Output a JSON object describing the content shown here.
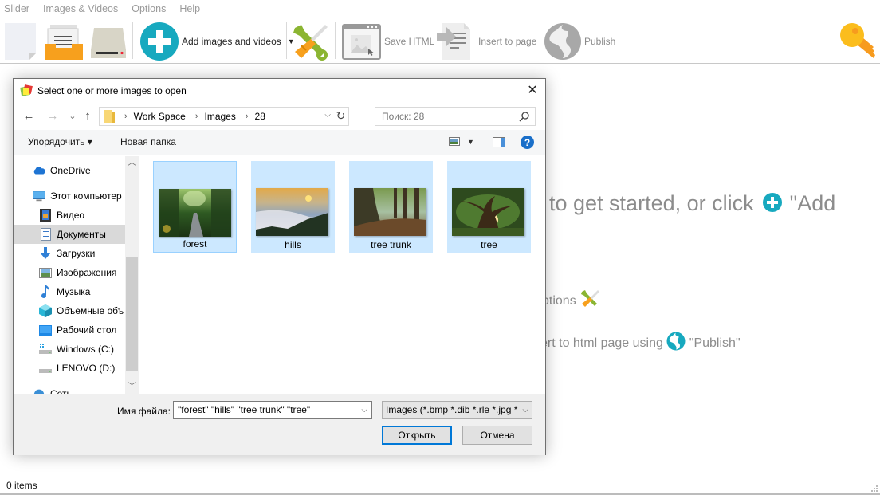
{
  "menubar": {
    "items": [
      "Slider",
      "Images & Videos",
      "Options",
      "Help"
    ]
  },
  "toolbar": {
    "new_icon": "blank-page-icon",
    "open_icon": "file-tray-icon",
    "save_icon": "disk-drive-icon",
    "add_label": "Add images and videos",
    "add_icon": "plus-circle-icon",
    "options_icon": "wrench-screwdriver-icon",
    "save_html_label": "Save HTML",
    "insert_label": "Insert to page",
    "publish_label": "Publish",
    "key_icon": "key-icon"
  },
  "colors": {
    "accent_teal": "#17a9bf",
    "orange": "#f5a623",
    "key_yellow": "#fbbd1d",
    "selection_blue": "#cce8ff",
    "primary_button_border": "#0078d7"
  },
  "welcome": {
    "line1_text": "to get started, or click",
    "line1_after": "\"Add",
    "line2_text": "ptions",
    "line3_text": "ert to html page using",
    "line3_after": "\"Publish\""
  },
  "status": {
    "items_count": "0 items"
  },
  "dialog": {
    "title": "Select one or more images to open",
    "close_label": "✕",
    "nav": {
      "back": "←",
      "forward": "→",
      "recent": "⌄",
      "up": "↑"
    },
    "breadcrumb": [
      "Work Space",
      "Images",
      "28"
    ],
    "search_placeholder": "Поиск: 28",
    "commands": {
      "organize": "Упорядочить ▾",
      "new_folder": "Новая папка"
    },
    "nav_pane": [
      {
        "label": "OneDrive",
        "icon": "onedrive-cloud-icon"
      },
      {
        "label": "Этот компьютер",
        "icon": "computer-icon"
      },
      {
        "label": "Видео",
        "icon": "video-icon"
      },
      {
        "label": "Документы",
        "icon": "documents-icon",
        "selected": true
      },
      {
        "label": "Загрузки",
        "icon": "downloads-icon"
      },
      {
        "label": "Изображения",
        "icon": "pictures-icon"
      },
      {
        "label": "Музыка",
        "icon": "music-icon"
      },
      {
        "label": "Объемные объ",
        "icon": "3d-objects-icon"
      },
      {
        "label": "Рабочий стол",
        "icon": "desktop-icon"
      },
      {
        "label": "Windows (C:)",
        "icon": "windows-drive-icon"
      },
      {
        "label": "LENOVO (D:)",
        "icon": "drive-icon"
      },
      {
        "label": "Сеть",
        "icon": "network-icon"
      }
    ],
    "files": [
      {
        "name": "forest",
        "focused": true
      },
      {
        "name": "hills",
        "focused": false
      },
      {
        "name": "tree trunk",
        "focused": false
      },
      {
        "name": "tree",
        "focused": false
      }
    ],
    "filename_label": "Имя файла:",
    "filename_value": "\"forest\" \"hills\" \"tree trunk\" \"tree\"",
    "filetype_value": "Images (*.bmp *.dib *.rle *.jpg *",
    "open_button": "Открыть",
    "cancel_button": "Отмена"
  }
}
